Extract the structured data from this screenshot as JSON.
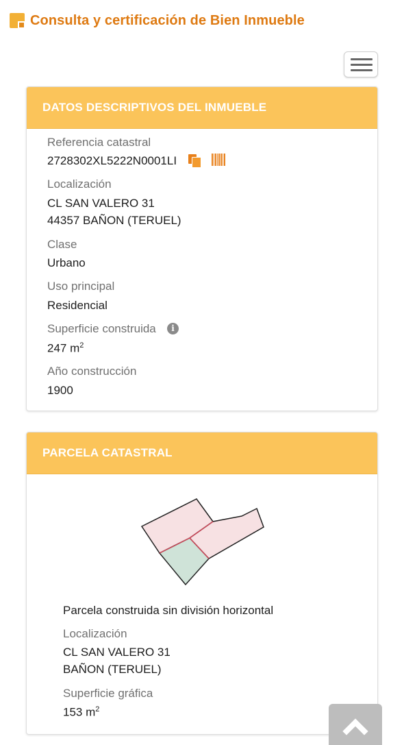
{
  "header": {
    "title": "Consulta y certificación de Bien Inmueble"
  },
  "descriptive": {
    "heading": "DATOS DESCRIPTIVOS DEL INMUEBLE",
    "ref_label": "Referencia catastral",
    "ref_value": "2728302XL5222N0001LI",
    "loc_label": "Localización",
    "loc_line1": "CL SAN VALERO 31",
    "loc_line2": "44357 BAÑON (TERUEL)",
    "clase_label": "Clase",
    "clase_value": "Urbano",
    "uso_label": "Uso principal",
    "uso_value": "Residencial",
    "sup_label": "Superficie construida",
    "sup_value": "247 m",
    "sup_unit_sup": "2",
    "ano_label": "Año construcción",
    "ano_value": "1900"
  },
  "parcel": {
    "heading": "PARCELA CATASTRAL",
    "type": "Parcela construida sin división horizontal",
    "loc_label": "Localización",
    "loc_line1": "CL SAN VALERO 31",
    "loc_line2": "BAÑON (TERUEL)",
    "sup_label": "Superficie gráfica",
    "sup_value": "153 m",
    "sup_unit_sup": "2"
  },
  "colors": {
    "accent": "#de7a12",
    "panel_header": "#fbc45a"
  }
}
